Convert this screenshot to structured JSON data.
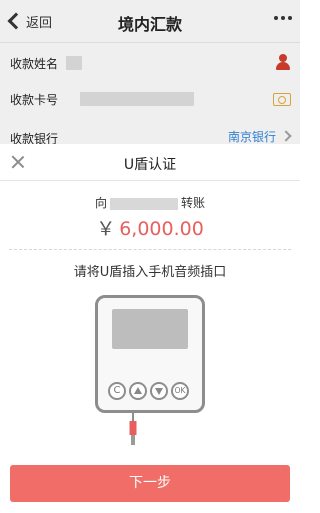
{
  "header": {
    "back_label": "返回",
    "title": "境内汇款"
  },
  "form": {
    "payee_name_label": "收款姓名",
    "card_number_label": "收款卡号",
    "bank_label": "收款银行",
    "bank_value": "南京银行"
  },
  "sheet": {
    "title": "U盾认证",
    "transfer_prefix": "向",
    "transfer_suffix": "转账",
    "currency_symbol": "￥",
    "amount": "6,000.00",
    "instruction": "请将U盾插入手机音频插口",
    "device_buttons": [
      "C",
      "▲",
      "▼",
      "OK"
    ],
    "next_button": "下一步"
  },
  "colors": {
    "accent": "#f06e67",
    "amount": "#e8605e",
    "bank_link": "#2f7fd1",
    "person_icon": "#c83a2a",
    "camera_icon": "#d8a43a"
  },
  "icons": {
    "back": "chevron-left-icon",
    "more": "more-dots-icon",
    "person": "person-icon",
    "camera": "camera-icon",
    "bank_arrow": "chevron-right-icon",
    "close": "close-icon"
  }
}
